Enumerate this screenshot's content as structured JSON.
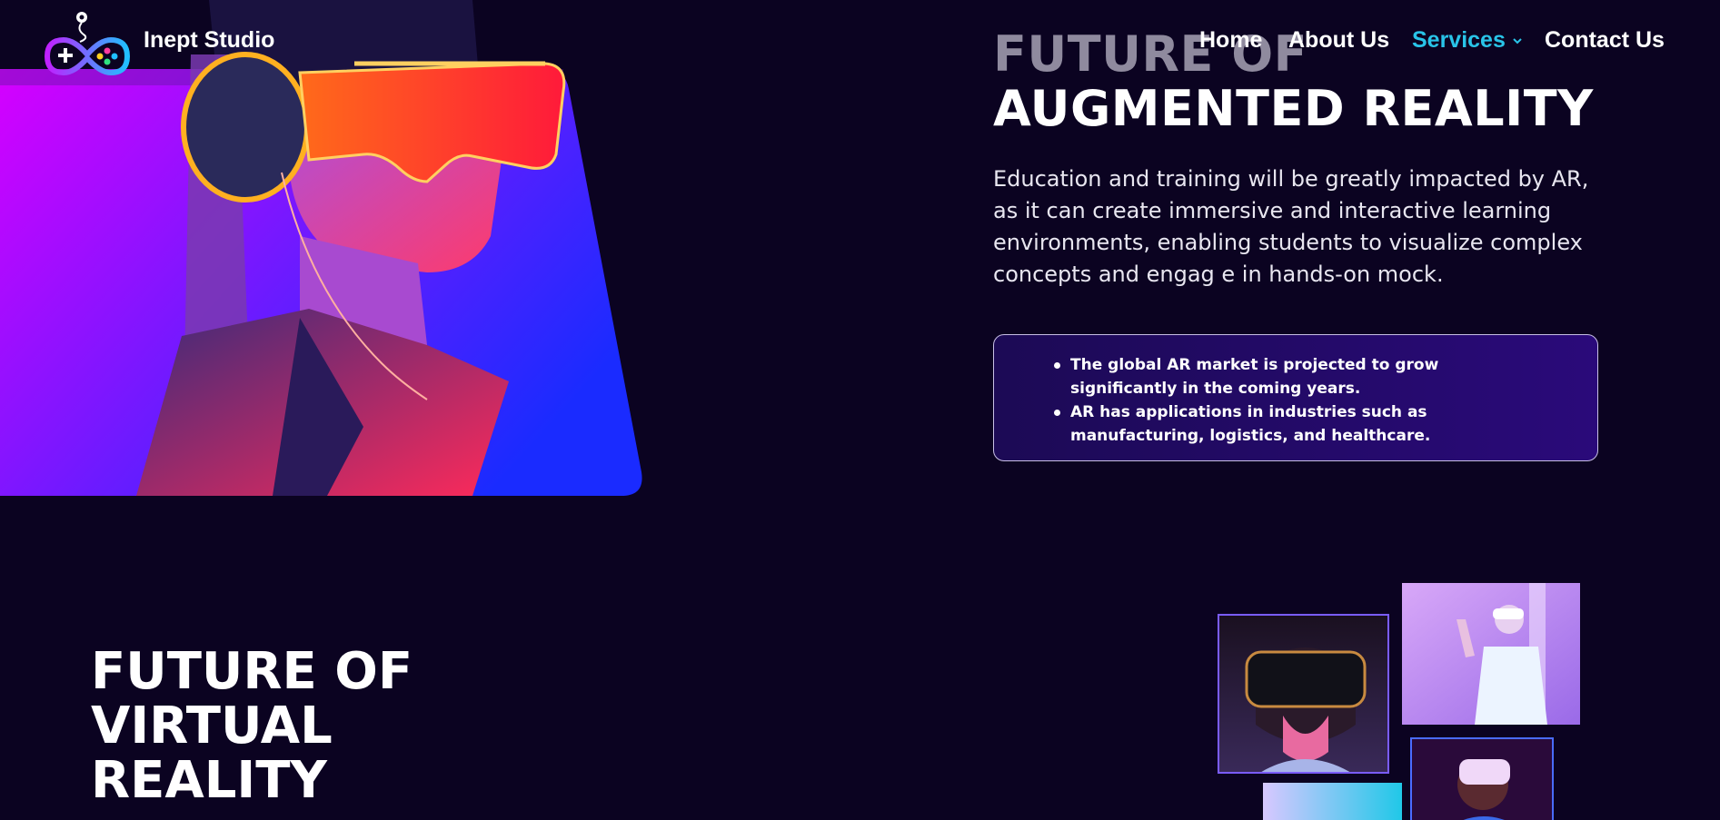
{
  "brand": {
    "name": "Inept Studio",
    "logo_icon": "gamepad-logo-icon"
  },
  "nav": {
    "items": [
      {
        "label": "Home"
      },
      {
        "label": "About Us"
      },
      {
        "label": "Services",
        "has_dropdown": true,
        "active": true
      },
      {
        "label": "Contact Us"
      }
    ]
  },
  "ar_section": {
    "title_line1": "FUTURE OF",
    "title_line2": "AUGMENTED REALITY",
    "description": "Education and training will be greatly impacted by AR, as it can create immersive and interactive learning environments, enabling students to visualize complex concepts and engag e in hands-on mock.",
    "facts": [
      "The global AR market is projected to grow significantly in the coming years.",
      "AR has applications in industries such as manufacturing, logistics, and healthcare."
    ]
  },
  "vr_section": {
    "title_line1": "FUTURE OF",
    "title_line2": "VIRTUAL",
    "title_line3": "REALITY"
  },
  "colors": {
    "background": "#0b0321",
    "accent": "#29c4e8",
    "hero_gradient_start": "#d600ff",
    "hero_gradient_end": "#1a2bff"
  }
}
